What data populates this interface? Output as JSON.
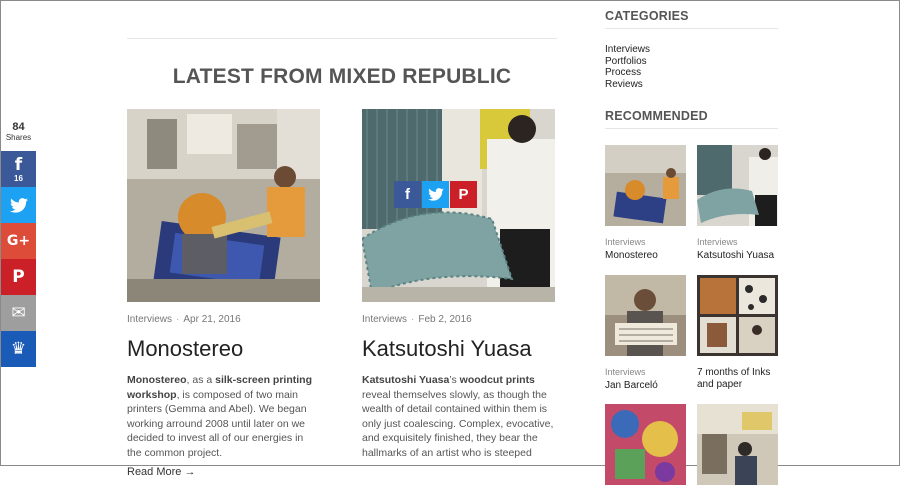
{
  "share": {
    "count": "84",
    "count_label": "Shares",
    "buttons": [
      {
        "name": "facebook",
        "glyph": "f",
        "count": "16",
        "color": "#3b5998"
      },
      {
        "name": "twitter",
        "glyph": "🐦",
        "count": "",
        "color": "#1da1f2"
      },
      {
        "name": "google-plus",
        "glyph": "G+",
        "count": "",
        "color": "#dd4b39"
      },
      {
        "name": "pinterest",
        "glyph": "P",
        "count": "",
        "color": "#cb2027"
      },
      {
        "name": "email",
        "glyph": "✉",
        "count": "",
        "color": "#9e9e9e"
      },
      {
        "name": "sumome",
        "glyph": "♛",
        "count": "",
        "color": "#1b5bb8"
      }
    ]
  },
  "main": {
    "section_title": "LATEST FROM MIXED REPUBLIC",
    "posts": [
      {
        "category": "Interviews",
        "date": "Apr 21, 2016",
        "title": "Monostereo",
        "excerpt_parts": [
          "Monostereo",
          ", as a ",
          "silk-screen printing workshop",
          ", is composed of two main printers (Gemma and Abel). We began working arround 2008 until later on we decided to invest all of our energies in the common project."
        ],
        "read_more": "Read More →"
      },
      {
        "category": "Interviews",
        "date": "Feb 2, 2016",
        "title": "Katsutoshi Yuasa",
        "excerpt_parts": [
          "Katsutoshi Yuasa",
          "’s ",
          "woodcut prints",
          " reveal themselves slowly, as though the wealth of detail contained within them is only just coalescing. Complex, evocative, and exquisitely finished, they bear the hallmarks of an artist who is steeped"
        ]
      }
    ]
  },
  "sidebar": {
    "categories_heading": "CATEGORIES",
    "categories": [
      "Interviews",
      "Portfolios",
      "Process",
      "Reviews"
    ],
    "recommended_heading": "RECOMMENDED",
    "recommended": [
      {
        "category": "Interviews",
        "title": "Monostereo"
      },
      {
        "category": "Interviews",
        "title": "Katsutoshi Yuasa"
      },
      {
        "category": "Interviews",
        "title": "Jan Barceló"
      },
      {
        "category": "",
        "title": "7 months of Inks and paper"
      },
      {
        "category": "",
        "title": ""
      },
      {
        "category": "",
        "title": ""
      }
    ]
  }
}
